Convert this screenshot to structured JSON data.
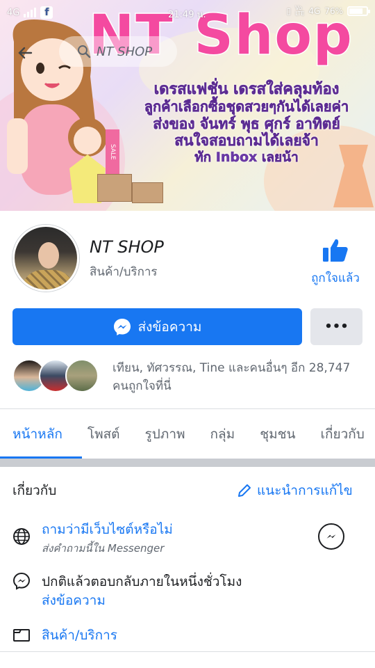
{
  "status_bar": {
    "network_left": "4G",
    "time": "21:49 น.",
    "network_right": "4G",
    "battery": "76%"
  },
  "search": {
    "placeholder": "NT SHOP"
  },
  "cover": {
    "logo": "NT Shop",
    "line1": "เดรสแฟชั่น เดรสใส่คลุมท้อง",
    "line2": "ลูกค้าเลือกซื้อชุดสวยๆกันได้เลยค่า",
    "line3": "ส่งของ จันทร์ พุธ ศุกร์ อาทิตย์",
    "line4": "สนใจสอบถามได้เลยจ้า",
    "line5": "ทัก Inbox เลยน้า",
    "sale_label": "SALE"
  },
  "profile": {
    "name": "NT SHOP",
    "category": "สินค้า/บริการ",
    "like_label": "ถูกใจแล้ว"
  },
  "actions": {
    "message_label": "ส่งข้อความ",
    "more_label": "•••"
  },
  "likers": {
    "text": "เทียน, ทัศวรรณ, Tine และคนอื่นๆ อีก 28,747 คนถูกใจที่นี่"
  },
  "tabs": [
    "หน้าหลัก",
    "โพสต์",
    "รูปภาพ",
    "กลุ่ม",
    "ชุมชน",
    "เกี่ยวกับ"
  ],
  "about": {
    "title": "เกี่ยวกับ",
    "suggest_edit": "แนะนำการแก้ไข",
    "website_question": "ถามว่ามีเว็บไซต์หรือไม่",
    "website_sub": "ส่งคำถามนี้ใน Messenger",
    "response_time": "ปกติแล้วตอบกลับภายในหนึ่งชั่วโมง",
    "send_message": "ส่งข้อความ",
    "category": "สินค้า/บริการ"
  },
  "colors": {
    "accent": "#1877f2",
    "button_grey": "#e4e6eb",
    "text_secondary": "#606770"
  }
}
